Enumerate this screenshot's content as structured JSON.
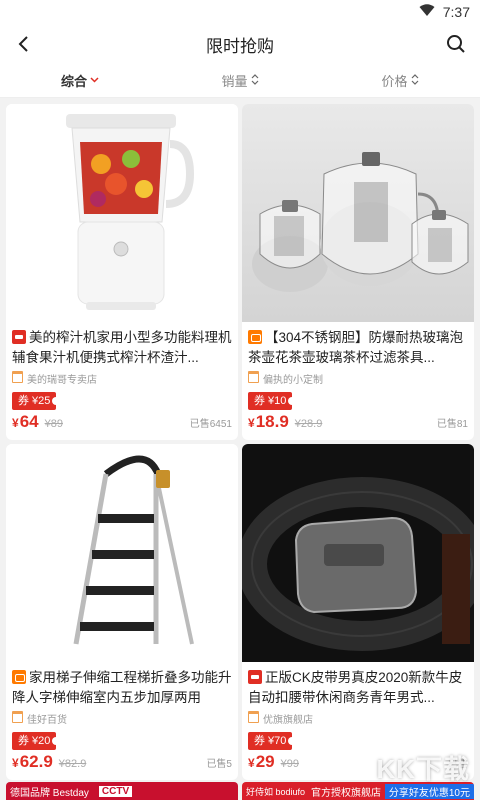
{
  "status_bar": {
    "time": "7:37"
  },
  "nav": {
    "title": "限时抢购"
  },
  "sort": {
    "tabs": [
      {
        "label": "综合",
        "active": true
      },
      {
        "label": "销量",
        "active": false
      },
      {
        "label": "价格",
        "active": false
      }
    ]
  },
  "products": [
    {
      "badge": "tmall",
      "title": "美的榨汁机家用小型多功能料理机辅食果汁机便携式榨汁杯渣汁...",
      "shop": "美的瑞哥专卖店",
      "coupon": "券 ¥25",
      "price_symbol": "¥",
      "price": "64",
      "old_price": "¥89",
      "sold": "已售6451"
    },
    {
      "badge": "taobao",
      "title": "【304不锈钢胆】防爆耐热玻璃泡茶壶花茶壶玻璃茶杯过滤茶具...",
      "shop": "偏执的小定制",
      "coupon": "券 ¥10",
      "price_symbol": "¥",
      "price": "18.9",
      "old_price": "¥28.9",
      "sold": "已售81"
    },
    {
      "badge": "taobao",
      "title": "家用梯子伸缩工程梯折叠多功能升降人字梯伸缩室内五步加厚两用",
      "shop": "佳好百货",
      "coupon": "券 ¥20",
      "price_symbol": "¥",
      "price": "62.9",
      "old_price": "¥82.9",
      "sold": "已售5"
    },
    {
      "badge": "tmall",
      "title": "正版CK皮带男真皮2020新款牛皮自动扣腰带休闲商务青年男式...",
      "shop": "优旗旗舰店",
      "coupon": "券 ¥70",
      "price_symbol": "¥",
      "price": "29",
      "old_price": "¥99",
      "sold": "已售"
    }
  ],
  "bottom_peek": {
    "left_text": "德国品牌 Bestday",
    "left_text2": "CCTV",
    "right_text": "官方授权旗舰店",
    "right_text2": "分享好友优惠10元",
    "right_brand": "好侍如 bodiufo"
  },
  "product_images": [
    "blender",
    "teapots",
    "ladder",
    "belt"
  ],
  "watermark": "KK下载",
  "colors": {
    "accent": "#e02e24",
    "background": "#f2f2f2",
    "tmall": "#e02e24",
    "taobao": "#ff7a00"
  }
}
